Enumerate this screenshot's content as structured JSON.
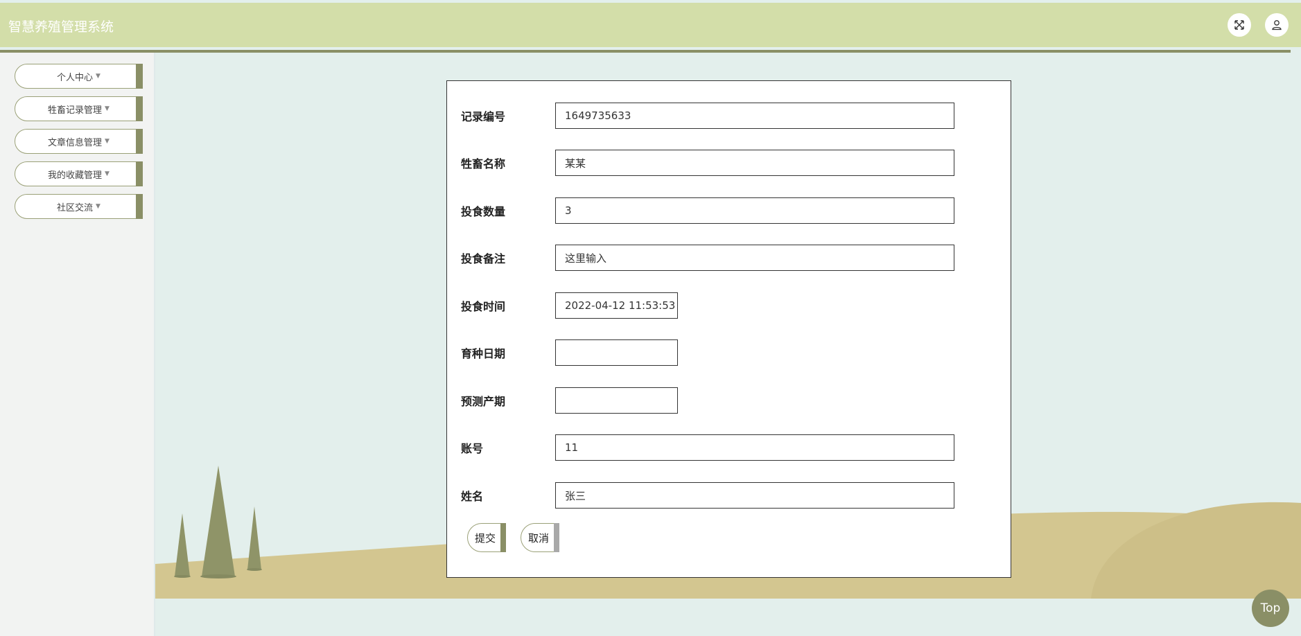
{
  "header": {
    "title": "智慧养殖管理系统",
    "fullscreen_icon": "expand-arrows-icon",
    "user_icon": "user-icon"
  },
  "sidebar": {
    "items": [
      {
        "label": "个人中心"
      },
      {
        "label": "牲畜记录管理"
      },
      {
        "label": "文章信息管理"
      },
      {
        "label": "我的收藏管理"
      },
      {
        "label": "社区交流"
      }
    ]
  },
  "form": {
    "fields": [
      {
        "label": "记录编号",
        "value": "1649735633"
      },
      {
        "label": "牲畜名称",
        "value": "某某"
      },
      {
        "label": "投食数量",
        "value": "3"
      },
      {
        "label": "投食备注",
        "value": "这里输入"
      },
      {
        "label": "投食时间",
        "value": "2022-04-12 11:53:53"
      },
      {
        "label": "育种日期",
        "value": ""
      },
      {
        "label": "预测产期",
        "value": ""
      },
      {
        "label": "账号",
        "value": "11"
      },
      {
        "label": "姓名",
        "value": "张三"
      }
    ],
    "submit_label": "提交",
    "cancel_label": "取消"
  },
  "back_to_top": "Top",
  "colors": {
    "header_bg": "#d3dea9",
    "accent": "#8a8f66",
    "page_bg": "#e3efec",
    "hill": "#d3c690"
  }
}
